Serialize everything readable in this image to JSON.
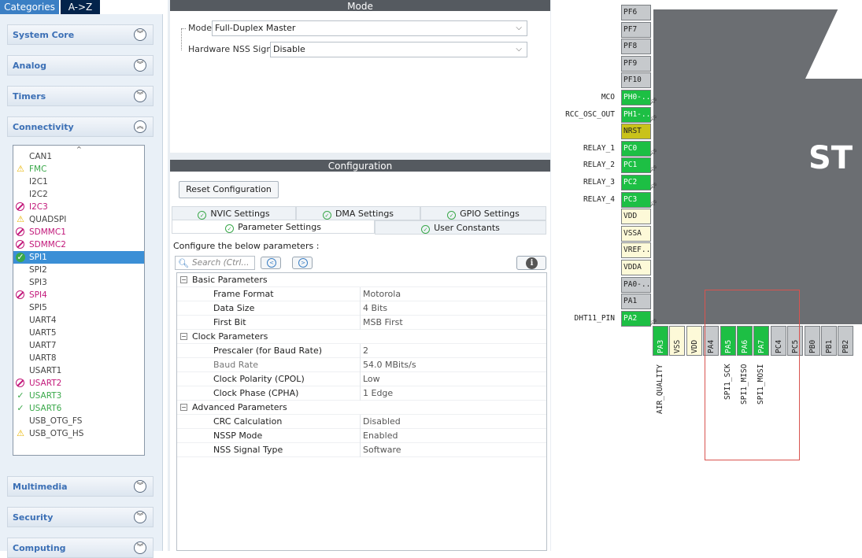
{
  "sidebar": {
    "tabs": {
      "categories": "Categories",
      "az": "A->Z"
    },
    "categories": {
      "system_core": "System Core",
      "analog": "Analog",
      "timers": "Timers",
      "connectivity": "Connectivity",
      "multimedia": "Multimedia",
      "security": "Security",
      "computing": "Computing"
    },
    "connectivity_items": [
      {
        "name": "CAN1",
        "status": "none"
      },
      {
        "name": "FMC",
        "status": "warning-green"
      },
      {
        "name": "I2C1",
        "status": "none"
      },
      {
        "name": "I2C2",
        "status": "none"
      },
      {
        "name": "I2C3",
        "status": "disabled"
      },
      {
        "name": "QUADSPI",
        "status": "warning"
      },
      {
        "name": "SDMMC1",
        "status": "disabled"
      },
      {
        "name": "SDMMC2",
        "status": "disabled"
      },
      {
        "name": "SPI1",
        "status": "ok-selected"
      },
      {
        "name": "SPI2",
        "status": "none"
      },
      {
        "name": "SPI3",
        "status": "none"
      },
      {
        "name": "SPI4",
        "status": "disabled"
      },
      {
        "name": "SPI5",
        "status": "none"
      },
      {
        "name": "UART4",
        "status": "none"
      },
      {
        "name": "UART5",
        "status": "none"
      },
      {
        "name": "UART7",
        "status": "none"
      },
      {
        "name": "UART8",
        "status": "none"
      },
      {
        "name": "USART1",
        "status": "none"
      },
      {
        "name": "USART2",
        "status": "disabled"
      },
      {
        "name": "USART3",
        "status": "ok"
      },
      {
        "name": "USART6",
        "status": "ok"
      },
      {
        "name": "USB_OTG_FS",
        "status": "none"
      },
      {
        "name": "USB_OTG_HS",
        "status": "warning"
      }
    ]
  },
  "mode": {
    "title": "Mode",
    "mode_label": "Mode",
    "mode_value": "Full-Duplex Master",
    "nss_label": "Hardware NSS Signal",
    "nss_value": "Disable"
  },
  "configuration": {
    "title": "Configuration",
    "reset_button": "Reset Configuration",
    "tabs": {
      "nvic": "NVIC Settings",
      "dma": "DMA Settings",
      "gpio": "GPIO Settings",
      "parameter": "Parameter Settings",
      "user_constants": "User Constants"
    },
    "configure_label": "Configure the below parameters :",
    "search_placeholder": "Search (Ctrl...",
    "groups": {
      "basic": "Basic Parameters",
      "clock": "Clock Parameters",
      "advanced": "Advanced Parameters"
    },
    "params": {
      "frame_format": {
        "name": "Frame Format",
        "value": "Motorola"
      },
      "data_size": {
        "name": "Data Size",
        "value": "4 Bits"
      },
      "first_bit": {
        "name": "First Bit",
        "value": "MSB First"
      },
      "prescaler": {
        "name": "Prescaler (for Baud Rate)",
        "value": "2"
      },
      "baud_rate": {
        "name": "Baud Rate",
        "value": "54.0 MBits/s"
      },
      "cpol": {
        "name": "Clock Polarity (CPOL)",
        "value": "Low"
      },
      "cpha": {
        "name": "Clock Phase (CPHA)",
        "value": "1 Edge"
      },
      "crc": {
        "name": "CRC Calculation",
        "value": "Disabled"
      },
      "nssp": {
        "name": "NSSP Mode",
        "value": "Enabled"
      },
      "nss_type": {
        "name": "NSS Signal Type",
        "value": "Software"
      }
    }
  },
  "chip": {
    "label": "ST",
    "left_pins": [
      {
        "pin": "PF6",
        "color": "gray",
        "signal": ""
      },
      {
        "pin": "PF7",
        "color": "gray",
        "signal": ""
      },
      {
        "pin": "PF8",
        "color": "gray",
        "signal": ""
      },
      {
        "pin": "PF9",
        "color": "gray",
        "signal": ""
      },
      {
        "pin": "PF10",
        "color": "gray",
        "signal": ""
      },
      {
        "pin": "PH0-...",
        "color": "green",
        "signal": "MCO"
      },
      {
        "pin": "PH1-...",
        "color": "green",
        "signal": "RCC_OSC_OUT"
      },
      {
        "pin": "NRST",
        "color": "yellow",
        "signal": ""
      },
      {
        "pin": "PC0",
        "color": "green",
        "signal": "RELAY_1"
      },
      {
        "pin": "PC1",
        "color": "green",
        "signal": "RELAY_2"
      },
      {
        "pin": "PC2",
        "color": "green",
        "signal": "RELAY_3"
      },
      {
        "pin": "PC3",
        "color": "green",
        "signal": "RELAY_4"
      },
      {
        "pin": "VDD",
        "color": "cream",
        "signal": ""
      },
      {
        "pin": "VSSA",
        "color": "cream",
        "signal": ""
      },
      {
        "pin": "VREF...",
        "color": "cream",
        "signal": ""
      },
      {
        "pin": "VDDA",
        "color": "cream",
        "signal": ""
      },
      {
        "pin": "PA0-...",
        "color": "gray",
        "signal": ""
      },
      {
        "pin": "PA1",
        "color": "gray",
        "signal": ""
      },
      {
        "pin": "PA2",
        "color": "green",
        "signal": "DHT11_PIN"
      }
    ],
    "bottom_pins": [
      {
        "pin": "PA3",
        "color": "green",
        "signal": "AIR_QUALITY"
      },
      {
        "pin": "VSS",
        "color": "cream",
        "signal": ""
      },
      {
        "pin": "VDD",
        "color": "cream",
        "signal": ""
      },
      {
        "pin": "PA4",
        "color": "gray",
        "signal": ""
      },
      {
        "pin": "PA5",
        "color": "green",
        "signal": "SPI1_SCK"
      },
      {
        "pin": "PA6",
        "color": "green",
        "signal": "SPI1_MISO"
      },
      {
        "pin": "PA7",
        "color": "green",
        "signal": "SPI1_MOSI"
      },
      {
        "pin": "PC4",
        "color": "gray",
        "signal": ""
      },
      {
        "pin": "PC5",
        "color": "gray",
        "signal": ""
      },
      {
        "pin": "PB0",
        "color": "gray",
        "signal": ""
      },
      {
        "pin": "PB1",
        "color": "gray",
        "signal": ""
      },
      {
        "pin": "PB2",
        "color": "gray",
        "signal": ""
      }
    ]
  }
}
